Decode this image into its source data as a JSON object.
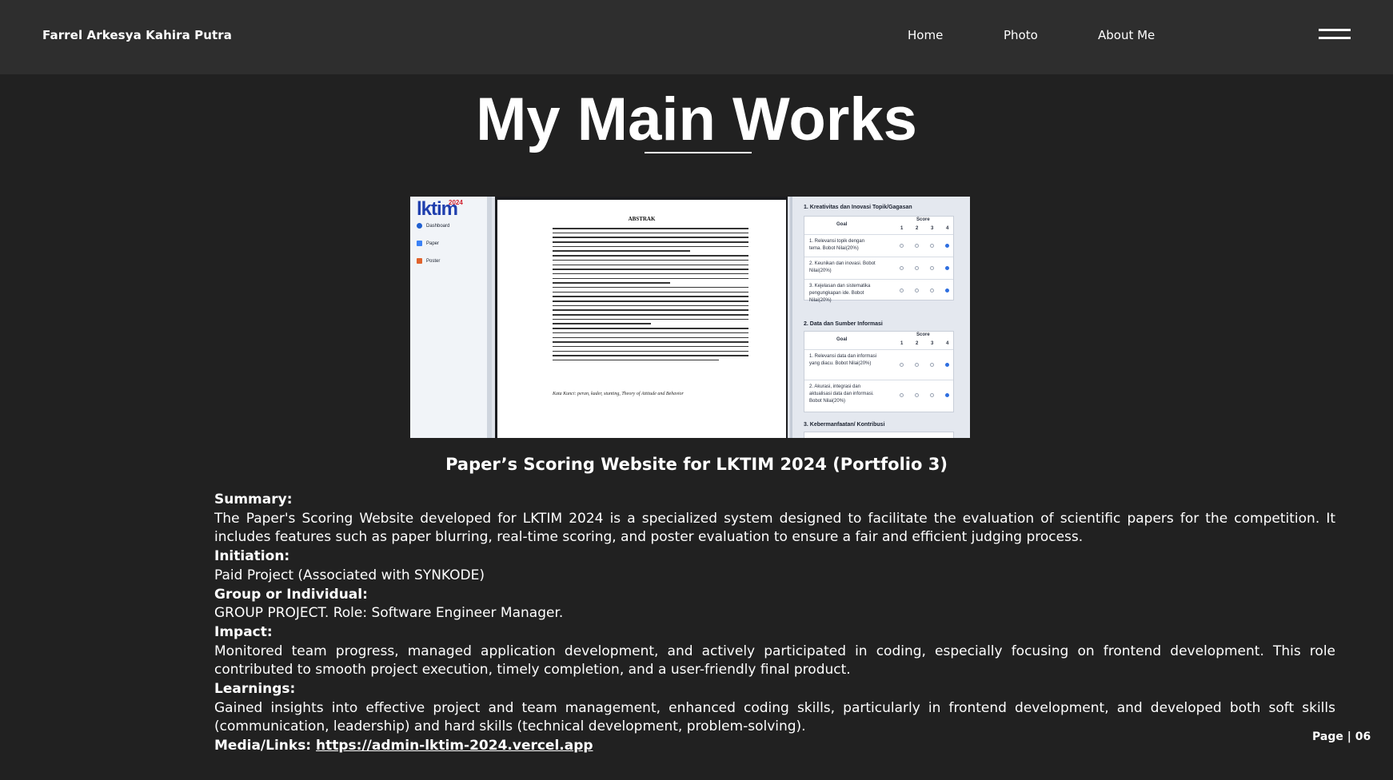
{
  "header": {
    "brand": "Farrel Arkesya Kahira Putra",
    "nav": [
      "Home",
      "Photo",
      "About Me"
    ],
    "menu_icon": "hamburger-icon"
  },
  "main": {
    "title": "My Main Works",
    "screenshot": {
      "sidebar": {
        "logo": "lktim",
        "logo_year": "2024",
        "items": [
          "Dashboard",
          "Paper",
          "Poster"
        ],
        "item_colors": [
          "#1f5fd0",
          "#3b82f6",
          "#e0622c"
        ]
      },
      "document": {
        "title": "ABSTRAK",
        "keywords": "Kata Kunci: peran, kader, stunting, Theory of Attitude and Behavior"
      },
      "form": {
        "section1": "1. Kreativitas dan Inovasi Topik/Gagasan",
        "section2": "2. Data dan Sumber Informasi",
        "section3": "3. Kebermanfaatan/ Kontribusi",
        "goal_header": "Goal",
        "score_header": "Score",
        "score_numbers": [
          "1",
          "2",
          "3",
          "4"
        ],
        "rows1": [
          "1. Relevansi topik dengan tema. Bobot Nilai(20%)",
          "2. Keunikan dan inovasi. Bobot Nilai(20%)",
          "3. Kejelasan dan sistematika pengungkapan ide. Bobot Nilai(20%)"
        ],
        "rows2": [
          "1. Relevansi data dan informasi yang diacu. Bobot Nilai(20%)",
          "2. Akurasi, integrasi dan aktualisasi data dan informasi. Bobot Nilai(20%)"
        ]
      }
    },
    "caption": "Paper’s Scoring Website for LKTIM 2024 (Portfolio 3)",
    "details": {
      "summary_label": "Summary:",
      "summary_text": "The Paper's Scoring Website developed for LKTIM 2024 is a specialized system designed to facilitate the evaluation of scientific papers for the competition. It includes features such as paper blurring, real-time scoring, and poster evaluation to ensure a fair and efficient judging process.",
      "initiation_label": "Initiation:",
      "initiation_text": "Paid Project (Associated with SYNKODE)",
      "group_label": "Group or Individual:",
      "group_text": "GROUP PROJECT. Role: Software Engineer Manager.",
      "impact_label": "Impact:",
      "impact_text": "Monitored team progress, managed application development, and actively participated in coding, especially focusing on frontend development. This role contributed to smooth project execution, timely completion, and a user-friendly final product.",
      "learnings_label": "Learnings:",
      "learnings_text": "Gained insights into effective project and team management, enhanced coding skills, particularly in frontend development, and developed both soft skills (communication, leadership) and hard skills (technical development, problem-solving).",
      "media_label": "Media/Links:",
      "media_link": "https://admin-lktim-2024.vercel.app"
    },
    "page_number": "Page | 06"
  }
}
